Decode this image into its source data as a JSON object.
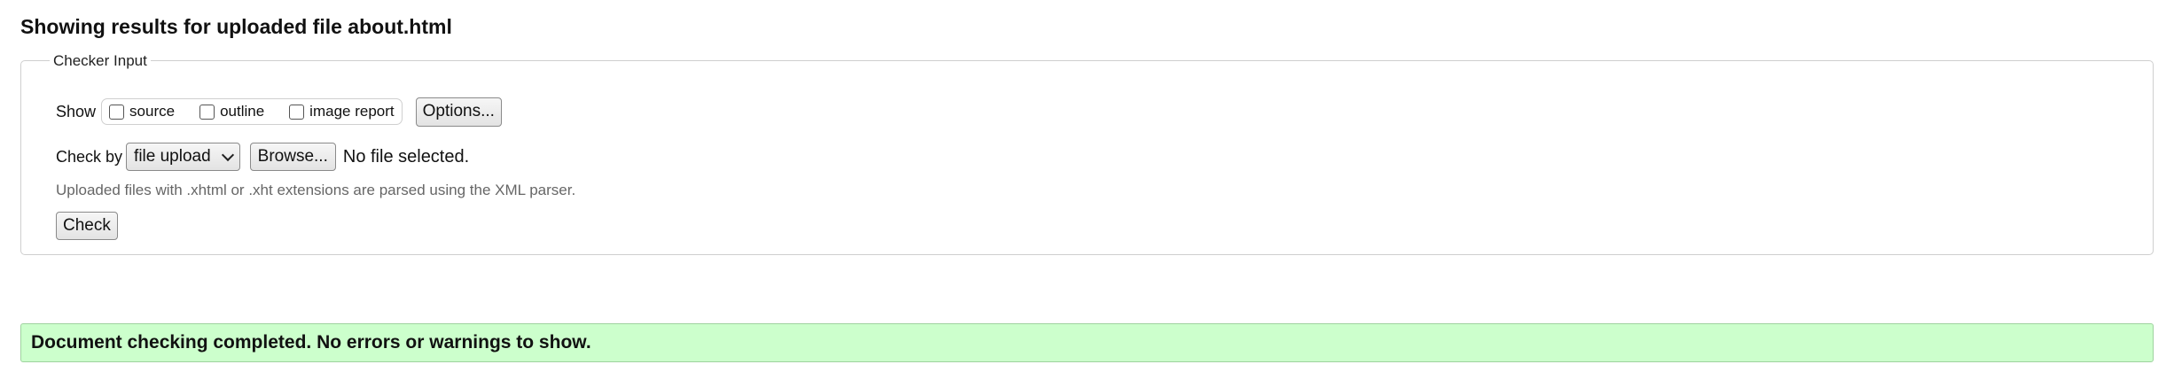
{
  "page": {
    "title": "Showing results for uploaded file about.html"
  },
  "checker": {
    "legend": "Checker Input",
    "show_label": "Show",
    "show_options": [
      {
        "label": "source",
        "checked": false
      },
      {
        "label": "outline",
        "checked": false
      },
      {
        "label": "image report",
        "checked": false
      }
    ],
    "options_button": "Options...",
    "check_by_label": "Check by",
    "check_by_selected": "file upload",
    "browse_button": "Browse...",
    "file_status": "No file selected.",
    "hint": "Uploaded files with .xhtml or .xht extensions are parsed using the XML parser.",
    "check_button": "Check"
  },
  "result": {
    "message": "Document checking completed. No errors or warnings to show.",
    "background_color": "#ccffcc"
  }
}
